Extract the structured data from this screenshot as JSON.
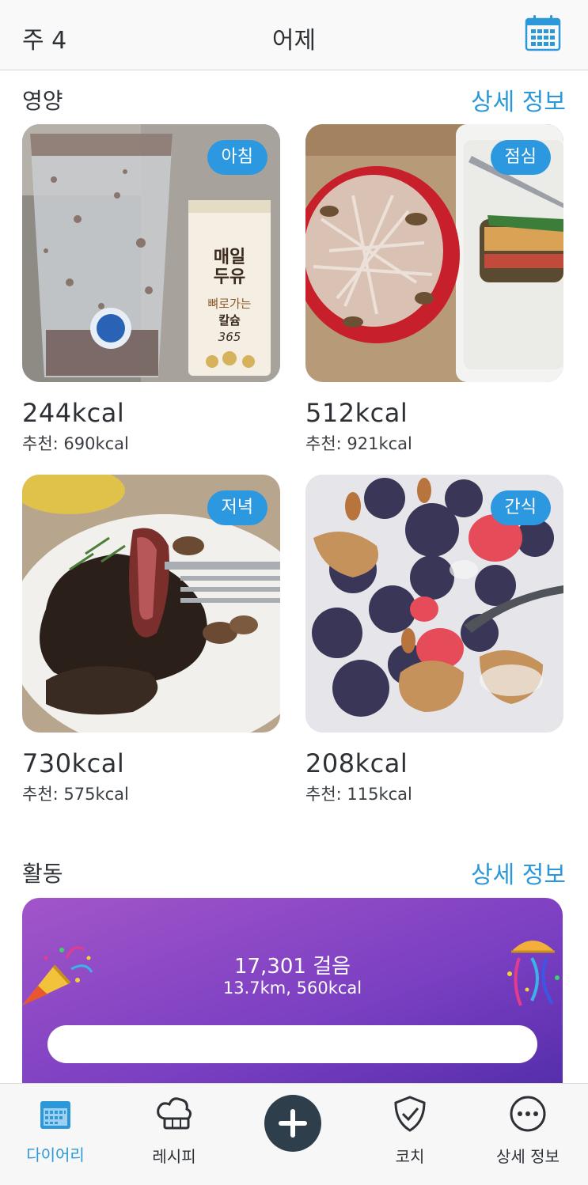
{
  "header": {
    "week": "주 4",
    "title": "어제",
    "calendar_icon": "calendar-icon"
  },
  "nutrition": {
    "title": "영양",
    "details_link": "상세 정보",
    "meals": [
      {
        "badge": "아침",
        "kcal": "244kcal",
        "recommended": "추천: 690kcal",
        "photo_text": [
          "매일",
          "두유",
          "뼈로가는",
          "칼슘",
          "365"
        ]
      },
      {
        "badge": "점심",
        "kcal": "512kcal",
        "recommended": "추천: 921kcal"
      },
      {
        "badge": "저녁",
        "kcal": "730kcal",
        "recommended": "추천: 575kcal"
      },
      {
        "badge": "간식",
        "kcal": "208kcal",
        "recommended": "추천: 115kcal"
      }
    ]
  },
  "activity": {
    "title": "활동",
    "details_link": "상세 정보",
    "steps": "17,301 걸음",
    "distance": "13.7km, 560kcal"
  },
  "tabbar": {
    "items": [
      {
        "label": "다이어리",
        "icon": "calendar-icon",
        "active": true
      },
      {
        "label": "레시피",
        "icon": "chef-hat-icon",
        "active": false
      },
      {
        "label": "",
        "icon": "plus-icon",
        "active": false
      },
      {
        "label": "코치",
        "icon": "shield-check-icon",
        "active": false
      },
      {
        "label": "상세 정보",
        "icon": "more-icon",
        "active": false
      }
    ]
  },
  "colors": {
    "accent": "#2b98d9",
    "badge": "#2b98e0",
    "activity_gradient_start": "#a255c9",
    "activity_gradient_end": "#4d2aa6",
    "add_button": "#2e3f4b"
  }
}
